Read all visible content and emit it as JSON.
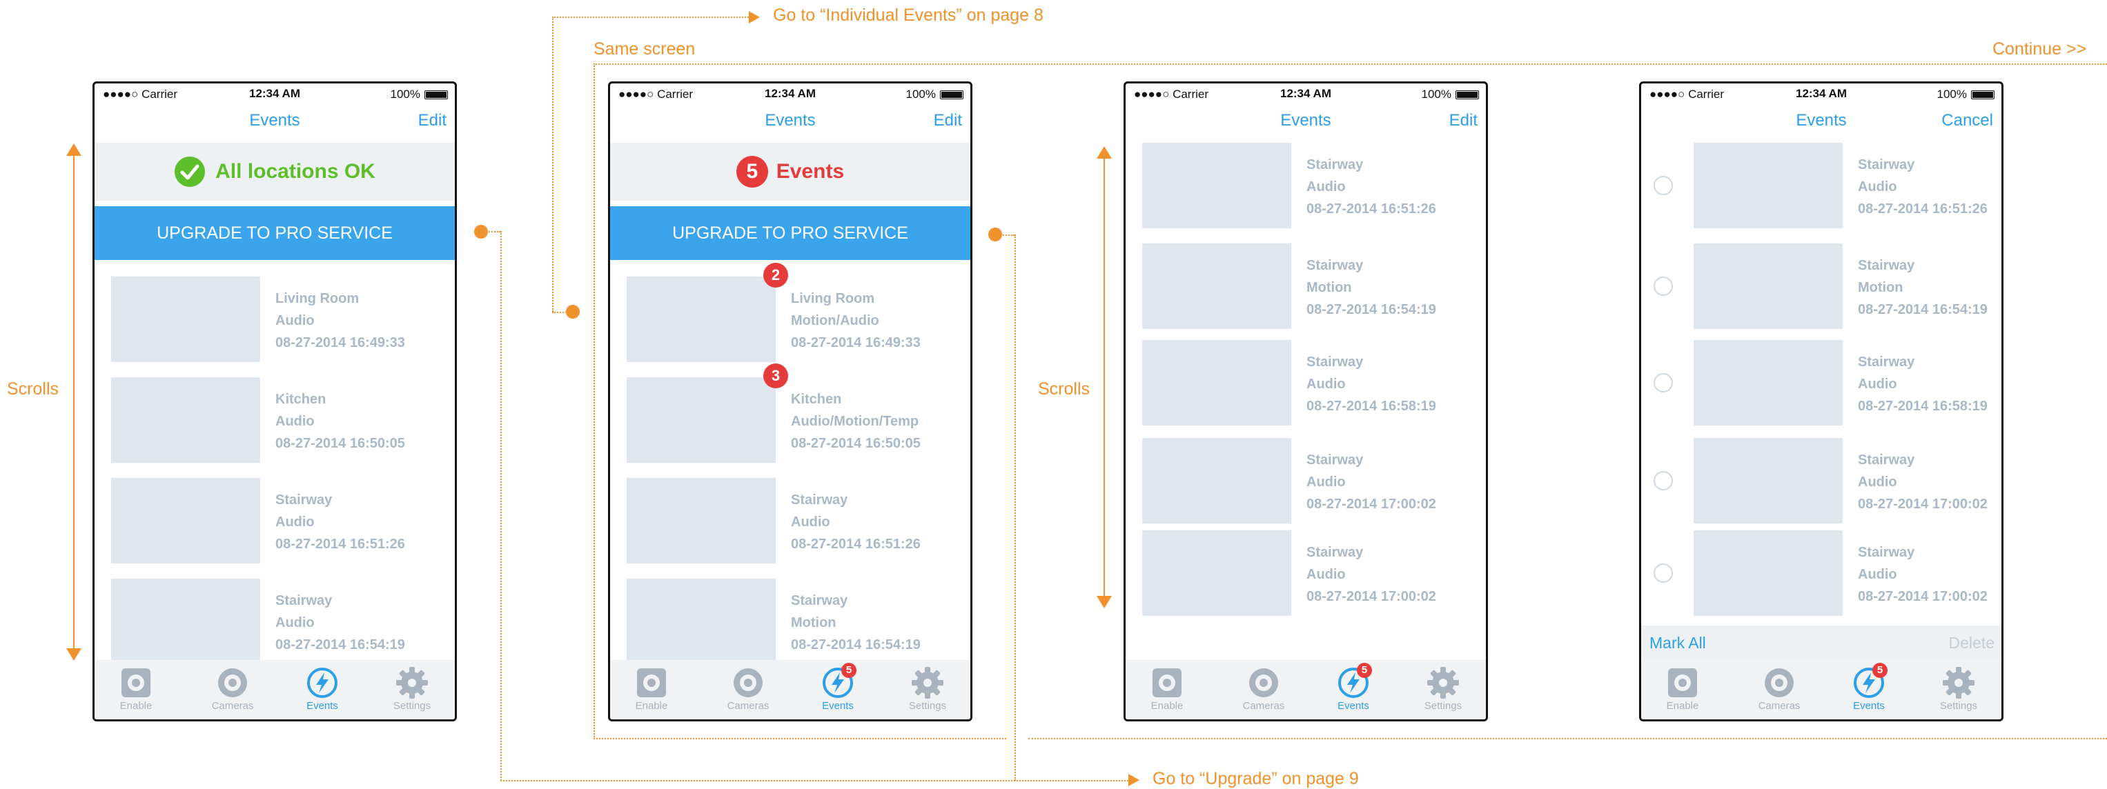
{
  "annotations": {
    "individual_events": "Go to “Individual Events” on page 8",
    "same_screen": "Same screen",
    "continue": "Continue >>",
    "scrolls_left": "Scrolls",
    "scrolls_mid": "Scrolls",
    "upgrade_link": "Go to “Upgrade” on page 9"
  },
  "colors": {
    "accent": "#2d9ee8",
    "annotation": "#f0922b",
    "ok": "#5cbf2a",
    "alert": "#e63b3b",
    "upgrade_bg": "#3aa4ec"
  },
  "phones": [
    {
      "status": {
        "carrier": "●●●●○ Carrier",
        "time": "12:34 AM",
        "battery": "100%"
      },
      "title": "Events",
      "nav_button": "Edit",
      "banner": {
        "text": "All locations OK",
        "icon": "check-circle-icon"
      },
      "upgrade": "UPGRADE TO PRO SERVICE",
      "events": [
        {
          "loc": "Living Room",
          "type": "Audio",
          "time": "08-27-2014 16:49:33"
        },
        {
          "loc": "Kitchen",
          "type": "Audio",
          "time": "08-27-2014 16:50:05"
        },
        {
          "loc": "Stairway",
          "type": "Audio",
          "time": "08-27-2014 16:51:26"
        },
        {
          "loc": "Stairway",
          "type": "Audio",
          "time": "08-27-2014 16:54:19"
        }
      ],
      "tabs": [
        {
          "label": "Enable"
        },
        {
          "label": "Cameras"
        },
        {
          "label": "Events"
        },
        {
          "label": "Settings"
        }
      ]
    },
    {
      "status": {
        "carrier": "●●●●○ Carrier",
        "time": "12:34 AM",
        "battery": "100%"
      },
      "title": "Events",
      "nav_button": "Edit",
      "banner": {
        "count": "5",
        "text": "Events"
      },
      "upgrade": "UPGRADE TO PRO SERVICE",
      "events": [
        {
          "loc": "Living Room",
          "type": "Motion/Audio",
          "time": "08-27-2014 16:49:33",
          "badge": "2"
        },
        {
          "loc": "Kitchen",
          "type": "Audio/Motion/Temp",
          "time": "08-27-2014 16:50:05",
          "badge": "3"
        },
        {
          "loc": "Stairway",
          "type": "Audio",
          "time": "08-27-2014 16:51:26"
        },
        {
          "loc": "Stairway",
          "type": "Motion",
          "time": "08-27-2014 16:54:19"
        }
      ],
      "tabs": [
        {
          "label": "Enable"
        },
        {
          "label": "Cameras"
        },
        {
          "label": "Events",
          "badge": "5"
        },
        {
          "label": "Settings"
        }
      ]
    },
    {
      "status": {
        "carrier": "●●●●○ Carrier",
        "time": "12:34 AM",
        "battery": "100%"
      },
      "title": "Events",
      "nav_button": "Edit",
      "events": [
        {
          "loc": "Stairway",
          "type": "Audio",
          "time": "08-27-2014 16:51:26"
        },
        {
          "loc": "Stairway",
          "type": "Motion",
          "time": "08-27-2014 16:54:19"
        },
        {
          "loc": "Stairway",
          "type": "Audio",
          "time": "08-27-2014 16:58:19"
        },
        {
          "loc": "Stairway",
          "type": "Audio",
          "time": "08-27-2014 17:00:02"
        },
        {
          "loc": "Stairway",
          "type": "Audio",
          "time": "08-27-2014 17:00:02"
        }
      ],
      "tabs": [
        {
          "label": "Enable"
        },
        {
          "label": "Cameras"
        },
        {
          "label": "Events",
          "badge": "5"
        },
        {
          "label": "Settings"
        }
      ]
    },
    {
      "status": {
        "carrier": "●●●●○ Carrier",
        "time": "12:34 AM",
        "battery": "100%"
      },
      "title": "Events",
      "nav_button": "Cancel",
      "events": [
        {
          "loc": "Stairway",
          "type": "Audio",
          "time": "08-27-2014 16:51:26"
        },
        {
          "loc": "Stairway",
          "type": "Motion",
          "time": "08-27-2014 16:54:19"
        },
        {
          "loc": "Stairway",
          "type": "Audio",
          "time": "08-27-2014 16:58:19"
        },
        {
          "loc": "Stairway",
          "type": "Audio",
          "time": "08-27-2014 17:00:02"
        },
        {
          "loc": "Stairway",
          "type": "Audio",
          "time": "08-27-2014 17:00:02"
        }
      ],
      "mark_all": "Mark All",
      "delete": "Delete",
      "tabs": [
        {
          "label": "Enable"
        },
        {
          "label": "Cameras"
        },
        {
          "label": "Events",
          "badge": "5"
        },
        {
          "label": "Settings"
        }
      ]
    }
  ]
}
